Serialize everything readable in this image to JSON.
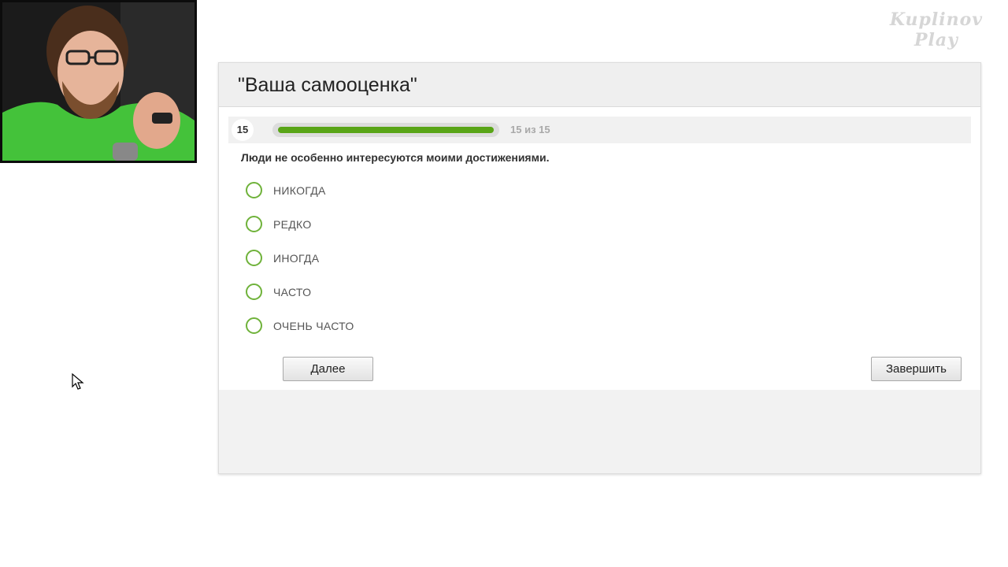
{
  "watermark": {
    "line1": "Kuplinov",
    "line2": "Play"
  },
  "quiz": {
    "title": "\"Ваша самооценка\"",
    "question_number": "15",
    "progress_text": "15 из 15",
    "progress_fraction": 1.0,
    "question": "Люди не особенно интересуются моими достижениями.",
    "options": [
      "НИКОГДА",
      "РЕДКО",
      "ИНОГДА",
      "ЧАСТО",
      "ОЧЕНЬ ЧАСТО"
    ],
    "next_label": "Далее",
    "finish_label": "Завершить"
  },
  "colors": {
    "accent_green": "#59a517",
    "radio_green": "#6fb23a"
  },
  "icons": {
    "cursor": "arrow-cursor-icon"
  }
}
